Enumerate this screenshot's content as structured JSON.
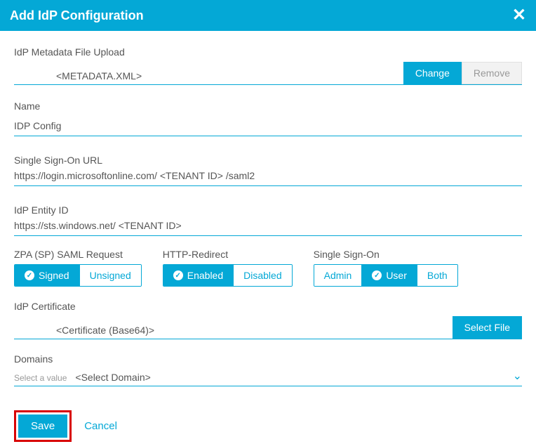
{
  "header": {
    "title": "Add IdP Configuration",
    "close_label": "✕"
  },
  "fields": {
    "metadata": {
      "label": "IdP Metadata File Upload",
      "value": "<METADATA.XML>",
      "change_btn": "Change",
      "remove_btn": "Remove"
    },
    "name": {
      "label": "Name",
      "value": "IDP Config"
    },
    "sso_url": {
      "label": "Single Sign-On URL",
      "prefix": "https://login.microsoftonline.com/",
      "tenant_token": "<TENANT ID>",
      "suffix": "/saml2"
    },
    "entity_id": {
      "label": "IdP Entity ID",
      "prefix": "https://sts.windows.net/",
      "tenant_token": "<TENANT ID>"
    },
    "saml_request": {
      "label": "ZPA (SP) SAML Request",
      "opt_signed": "Signed",
      "opt_unsigned": "Unsigned"
    },
    "http_redirect": {
      "label": "HTTP-Redirect",
      "opt_enabled": "Enabled",
      "opt_disabled": "Disabled"
    },
    "sso_mode": {
      "label": "Single Sign-On",
      "opt_admin": "Admin",
      "opt_user": "User",
      "opt_both": "Both"
    },
    "cert": {
      "label": "IdP Certificate",
      "value": "<Certificate (Base64)>",
      "select_btn": "Select File"
    },
    "domains": {
      "label": "Domains",
      "placeholder": "Select a value",
      "value": "<Select Domain>"
    }
  },
  "footer": {
    "save": "Save",
    "cancel": "Cancel"
  }
}
